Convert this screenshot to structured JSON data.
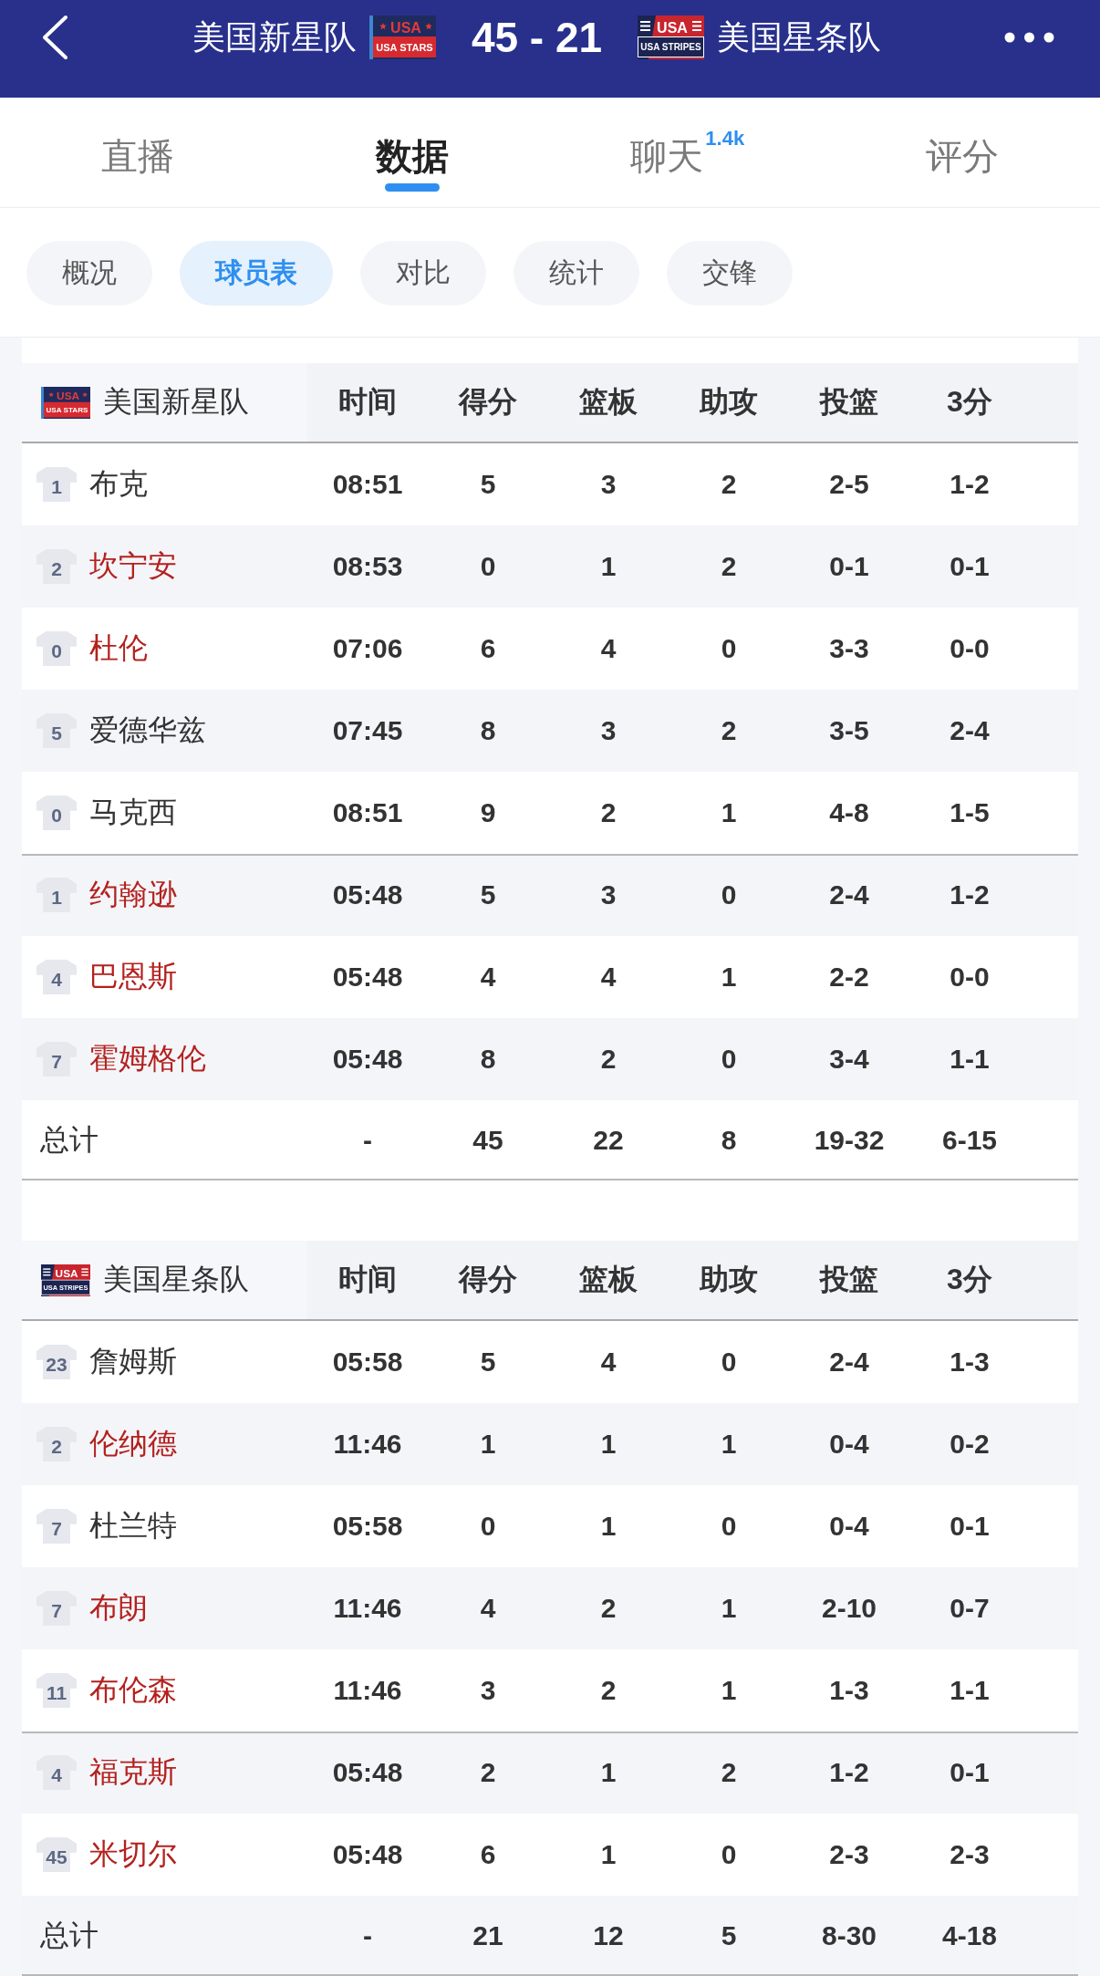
{
  "header": {
    "home": {
      "name": "美国新星队",
      "logo": {
        "kind": "stars",
        "wordmark": "USA",
        "caption": "USA STARS"
      }
    },
    "score": "45 - 21",
    "away": {
      "name": "美国星条队",
      "logo": {
        "kind": "stripes",
        "wordmark": "USA",
        "caption": "USA STRIPES"
      }
    }
  },
  "tabs": [
    {
      "label": "直播",
      "selected": false
    },
    {
      "label": "数据",
      "selected": true
    },
    {
      "label": "聊天",
      "badge": "1.4k",
      "selected": false
    },
    {
      "label": "评分",
      "selected": false
    }
  ],
  "sub_tabs": [
    {
      "label": "概况",
      "selected": false
    },
    {
      "label": "球员表",
      "selected": true
    },
    {
      "label": "对比",
      "selected": false
    },
    {
      "label": "统计",
      "selected": false
    },
    {
      "label": "交锋",
      "selected": false
    }
  ],
  "tables": [
    {
      "team": "美国新星队",
      "logo": {
        "kind": "stars",
        "wordmark": "USA",
        "caption": "USA STARS"
      },
      "columns": [
        "时间",
        "得分",
        "篮板",
        "助攻",
        "投篮",
        "3分"
      ],
      "starters": [
        {
          "number": "1",
          "name": "布克",
          "color": "#333333",
          "stats": [
            "08:51",
            "5",
            "3",
            "2",
            "2-5",
            "1-2"
          ]
        },
        {
          "number": "2",
          "name": "坎宁安",
          "color": "#b3211e",
          "stats": [
            "08:53",
            "0",
            "1",
            "2",
            "0-1",
            "0-1"
          ]
        },
        {
          "number": "0",
          "name": "杜伦",
          "color": "#b3211e",
          "stats": [
            "07:06",
            "6",
            "4",
            "0",
            "3-3",
            "0-0"
          ]
        },
        {
          "number": "5",
          "name": "爱德华兹",
          "color": "#333333",
          "stats": [
            "07:45",
            "8",
            "3",
            "2",
            "3-5",
            "2-4"
          ]
        },
        {
          "number": "0",
          "name": "马克西",
          "color": "#333333",
          "stats": [
            "08:51",
            "9",
            "2",
            "1",
            "4-8",
            "1-5"
          ]
        }
      ],
      "bench": [
        {
          "number": "1",
          "name": "约翰逊",
          "color": "#b3211e",
          "stats": [
            "05:48",
            "5",
            "3",
            "0",
            "2-4",
            "1-2"
          ]
        },
        {
          "number": "4",
          "name": "巴恩斯",
          "color": "#b3211e",
          "stats": [
            "05:48",
            "4",
            "4",
            "1",
            "2-2",
            "0-0"
          ]
        },
        {
          "number": "7",
          "name": "霍姆格伦",
          "color": "#b3211e",
          "stats": [
            "05:48",
            "8",
            "2",
            "0",
            "3-4",
            "1-1"
          ]
        }
      ],
      "total": {
        "label": "总计",
        "stats": [
          "-",
          "45",
          "22",
          "8",
          "19-32",
          "6-15"
        ]
      }
    },
    {
      "team": "美国星条队",
      "logo": {
        "kind": "stripes",
        "wordmark": "USA",
        "caption": "USA STRIPES"
      },
      "columns": [
        "时间",
        "得分",
        "篮板",
        "助攻",
        "投篮",
        "3分"
      ],
      "starters": [
        {
          "number": "23",
          "name": "詹姆斯",
          "color": "#333333",
          "stats": [
            "05:58",
            "5",
            "4",
            "0",
            "2-4",
            "1-3"
          ]
        },
        {
          "number": "2",
          "name": "伦纳德",
          "color": "#b3211e",
          "stats": [
            "11:46",
            "1",
            "1",
            "1",
            "0-4",
            "0-2"
          ]
        },
        {
          "number": "7",
          "name": "杜兰特",
          "color": "#333333",
          "stats": [
            "05:58",
            "0",
            "1",
            "0",
            "0-4",
            "0-1"
          ]
        },
        {
          "number": "7",
          "name": "布朗",
          "color": "#b3211e",
          "stats": [
            "11:46",
            "4",
            "2",
            "1",
            "2-10",
            "0-7"
          ]
        },
        {
          "number": "11",
          "name": "布伦森",
          "color": "#b3211e",
          "stats": [
            "11:46",
            "3",
            "2",
            "1",
            "1-3",
            "1-1"
          ]
        }
      ],
      "bench": [
        {
          "number": "4",
          "name": "福克斯",
          "color": "#b3211e",
          "stats": [
            "05:48",
            "2",
            "1",
            "2",
            "1-2",
            "0-1"
          ]
        },
        {
          "number": "45",
          "name": "米切尔",
          "color": "#b3211e",
          "stats": [
            "05:48",
            "6",
            "1",
            "0",
            "2-3",
            "2-3"
          ]
        }
      ],
      "total": {
        "label": "总计",
        "stats": [
          "-",
          "21",
          "12",
          "5",
          "8-30",
          "4-18"
        ]
      }
    }
  ]
}
